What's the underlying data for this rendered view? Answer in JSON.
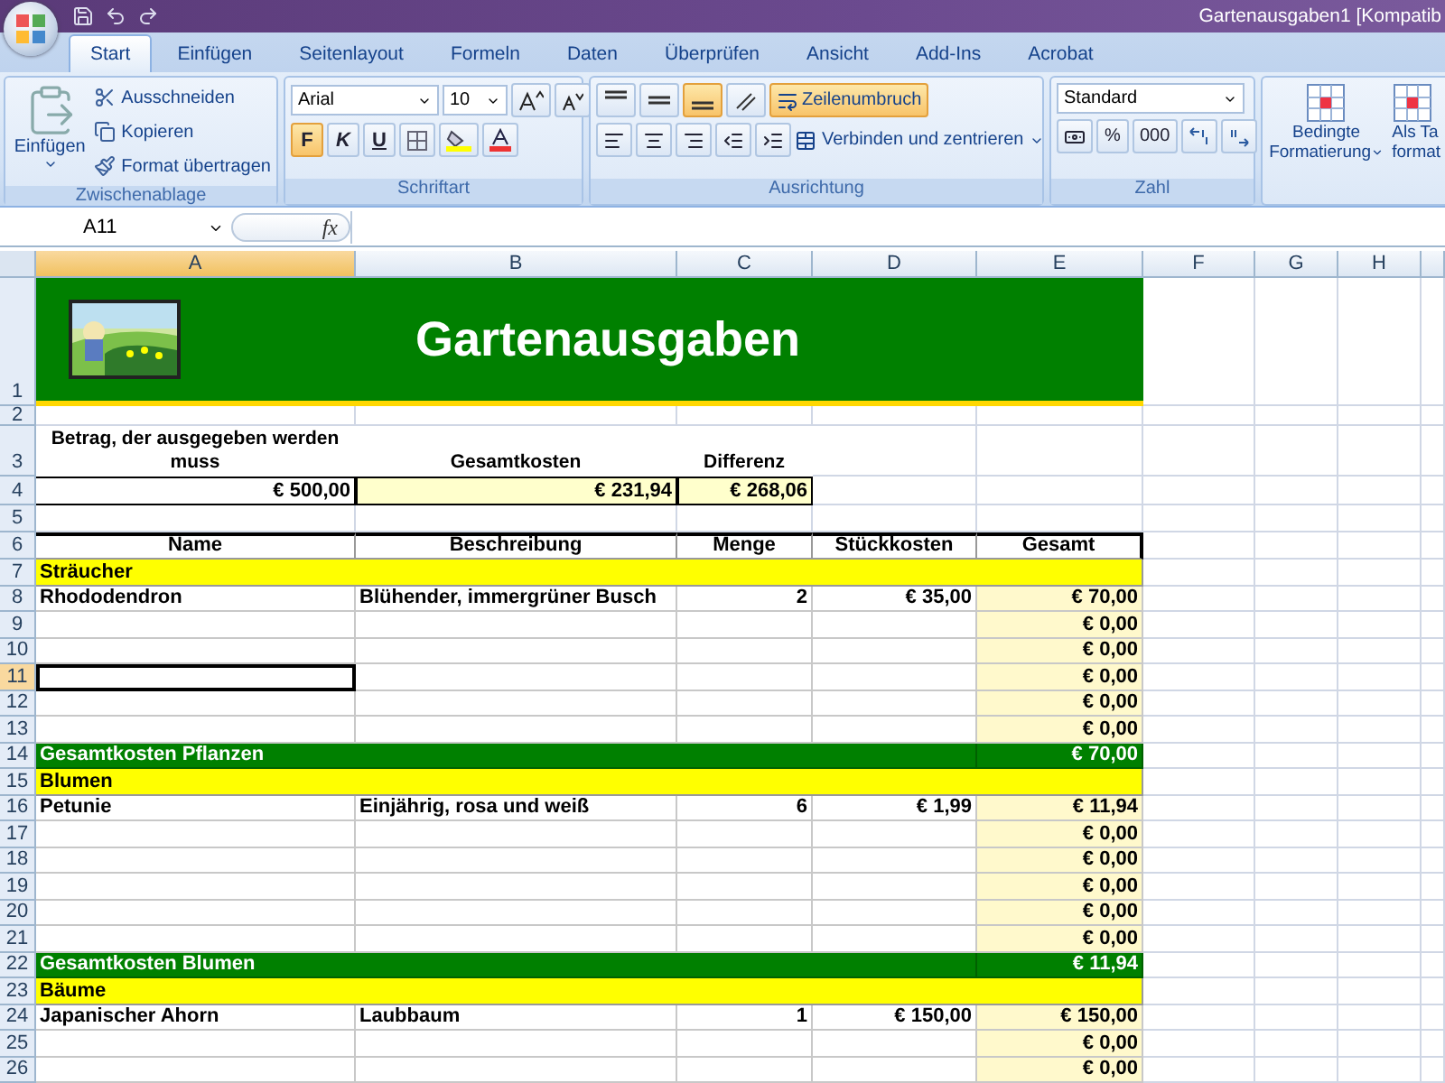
{
  "window": {
    "title": "Gartenausgaben1  [Kompatib"
  },
  "tabs": [
    {
      "label": "Start",
      "selected": true
    },
    {
      "label": "Einfügen",
      "selected": false
    },
    {
      "label": "Seitenlayout",
      "selected": false
    },
    {
      "label": "Formeln",
      "selected": false
    },
    {
      "label": "Daten",
      "selected": false
    },
    {
      "label": "Überprüfen",
      "selected": false
    },
    {
      "label": "Ansicht",
      "selected": false
    },
    {
      "label": "Add-Ins",
      "selected": false
    },
    {
      "label": "Acrobat",
      "selected": false
    }
  ],
  "ribbon": {
    "groups": [
      {
        "kind": "clipboard",
        "label": "Zwischenablage",
        "paste": "Einfügen",
        "items": [
          "Ausschneiden",
          "Kopieren",
          "Format übertragen"
        ]
      },
      {
        "kind": "font",
        "label": "Schriftart",
        "font": "Arial",
        "size": "10",
        "styles": [
          {
            "label": "F",
            "active": true
          },
          {
            "label": "K",
            "active": false
          },
          {
            "label": "U",
            "active": false
          }
        ]
      },
      {
        "kind": "alignment",
        "label": "Ausrichtung",
        "valign": [
          {
            "active": false
          },
          {
            "active": false
          },
          {
            "active": true
          }
        ],
        "wrap": {
          "label": "Zeilenumbruch",
          "active": true
        },
        "merge": "Verbinden und zentrieren"
      },
      {
        "kind": "number",
        "label": "Zahl",
        "format": "Standard",
        "buttons": [
          "%",
          "000"
        ]
      },
      {
        "kind": "styles",
        "buttons": [
          {
            "lines": [
              "Bedingte",
              "Formatierung"
            ]
          },
          {
            "lines": [
              "Als Ta",
              "format"
            ]
          }
        ]
      }
    ]
  },
  "formula_bar": {
    "name_box": "A11",
    "fx": "fx"
  },
  "sheet": {
    "columns": [
      {
        "label": "A",
        "selected": true
      },
      {
        "label": "B",
        "selected": false
      },
      {
        "label": "C",
        "selected": false
      },
      {
        "label": "D",
        "selected": false
      },
      {
        "label": "E",
        "selected": false
      },
      {
        "label": "F",
        "selected": false
      },
      {
        "label": "G",
        "selected": false
      },
      {
        "label": "H",
        "selected": false
      }
    ],
    "row_numbers": [
      {
        "label": "1",
        "selected": false
      },
      {
        "label": "2",
        "selected": false
      },
      {
        "label": "3",
        "selected": false
      },
      {
        "label": "4",
        "selected": false
      },
      {
        "label": "5",
        "selected": false
      },
      {
        "label": "6",
        "selected": false
      },
      {
        "label": "7",
        "selected": false
      },
      {
        "label": "8",
        "selected": false
      },
      {
        "label": "9",
        "selected": false
      },
      {
        "label": "10",
        "selected": false
      },
      {
        "label": "11",
        "selected": true
      },
      {
        "label": "12",
        "selected": false
      },
      {
        "label": "13",
        "selected": false
      },
      {
        "label": "14",
        "selected": false
      },
      {
        "label": "15",
        "selected": false
      },
      {
        "label": "16",
        "selected": false
      },
      {
        "label": "17",
        "selected": false
      },
      {
        "label": "18",
        "selected": false
      },
      {
        "label": "19",
        "selected": false
      },
      {
        "label": "20",
        "selected": false
      },
      {
        "label": "21",
        "selected": false
      },
      {
        "label": "22",
        "selected": false
      },
      {
        "label": "23",
        "selected": false
      },
      {
        "label": "24",
        "selected": false
      },
      {
        "label": "25",
        "selected": false
      },
      {
        "label": "26",
        "selected": false
      }
    ],
    "banner": {
      "title": "Gartenausgaben"
    },
    "summary": {
      "labels": [
        "Betrag, der ausgegeben werden muss",
        "Gesamtkosten",
        "Differenz"
      ],
      "values": [
        "€ 500,00",
        "€ 231,94",
        "€ 268,06"
      ]
    },
    "table": {
      "headers": [
        "Name",
        "Beschreibung",
        "Menge",
        "Stückkosten",
        "Gesamt"
      ],
      "rows": [
        {
          "kind": "section",
          "label": "Sträucher"
        },
        {
          "kind": "item",
          "name": "Rhododendron",
          "description": "Blühender, immergrüner Busch",
          "quantity": "2",
          "unit_cost": "€ 35,00",
          "total": "€ 70,00",
          "selected": false
        },
        {
          "kind": "item",
          "total": "€ 0,00",
          "selected": false
        },
        {
          "kind": "item",
          "total": "€ 0,00",
          "selected": false
        },
        {
          "kind": "item",
          "total": "€ 0,00",
          "selected": true
        },
        {
          "kind": "item",
          "total": "€ 0,00",
          "selected": false
        },
        {
          "kind": "item",
          "total": "€ 0,00",
          "selected": false
        },
        {
          "kind": "total",
          "label": "Gesamtkosten Pflanzen",
          "total": "€ 70,00"
        },
        {
          "kind": "section",
          "label": "Blumen"
        },
        {
          "kind": "item",
          "name": "Petunie",
          "description": "Einjährig, rosa und weiß",
          "quantity": "6",
          "unit_cost": "€ 1,99",
          "total": "€ 11,94",
          "selected": false
        },
        {
          "kind": "item",
          "total": "€ 0,00",
          "selected": false
        },
        {
          "kind": "item",
          "total": "€ 0,00",
          "selected": false
        },
        {
          "kind": "item",
          "total": "€ 0,00",
          "selected": false
        },
        {
          "kind": "item",
          "total": "€ 0,00",
          "selected": false
        },
        {
          "kind": "item",
          "total": "€ 0,00",
          "selected": false
        },
        {
          "kind": "total",
          "label": "Gesamtkosten Blumen",
          "total": "€ 11,94"
        },
        {
          "kind": "section",
          "label": "Bäume"
        },
        {
          "kind": "item",
          "name": "Japanischer Ahorn",
          "description": "Laubbaum",
          "quantity": "1",
          "unit_cost": "€ 150,00",
          "total": "€ 150,00",
          "selected": false
        },
        {
          "kind": "item",
          "total": "€ 0,00",
          "selected": false
        },
        {
          "kind": "item",
          "total": "€ 0,00",
          "selected": false
        }
      ]
    }
  }
}
